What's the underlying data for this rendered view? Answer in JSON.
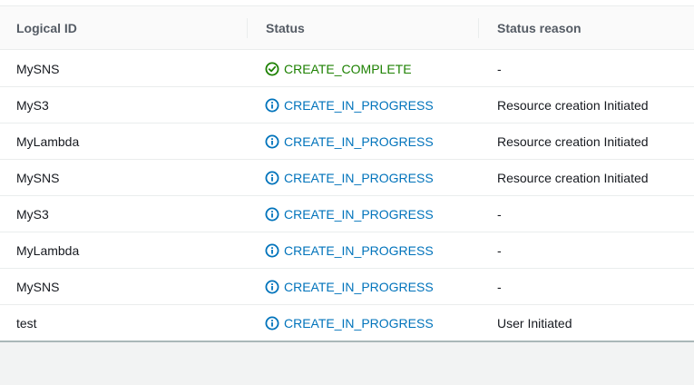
{
  "table": {
    "columns": [
      "Logical ID",
      "Status",
      "Status reason"
    ],
    "rows": [
      {
        "logical_id": "MySNS",
        "status": "CREATE_COMPLETE",
        "status_type": "complete",
        "reason": "-"
      },
      {
        "logical_id": "MyS3",
        "status": "CREATE_IN_PROGRESS",
        "status_type": "progress",
        "reason": "Resource creation Initiated"
      },
      {
        "logical_id": "MyLambda",
        "status": "CREATE_IN_PROGRESS",
        "status_type": "progress",
        "reason": "Resource creation Initiated"
      },
      {
        "logical_id": "MySNS",
        "status": "CREATE_IN_PROGRESS",
        "status_type": "progress",
        "reason": "Resource creation Initiated"
      },
      {
        "logical_id": "MyS3",
        "status": "CREATE_IN_PROGRESS",
        "status_type": "progress",
        "reason": "-"
      },
      {
        "logical_id": "MyLambda",
        "status": "CREATE_IN_PROGRESS",
        "status_type": "progress",
        "reason": "-"
      },
      {
        "logical_id": "MySNS",
        "status": "CREATE_IN_PROGRESS",
        "status_type": "progress",
        "reason": "-"
      },
      {
        "logical_id": "test",
        "status": "CREATE_IN_PROGRESS",
        "status_type": "progress",
        "reason": "User Initiated"
      }
    ]
  },
  "icons": {
    "complete": "check-circle-icon",
    "progress": "info-circle-icon"
  },
  "colors": {
    "complete": "#1d8102",
    "progress": "#0073bb",
    "header_text": "#545b64"
  }
}
